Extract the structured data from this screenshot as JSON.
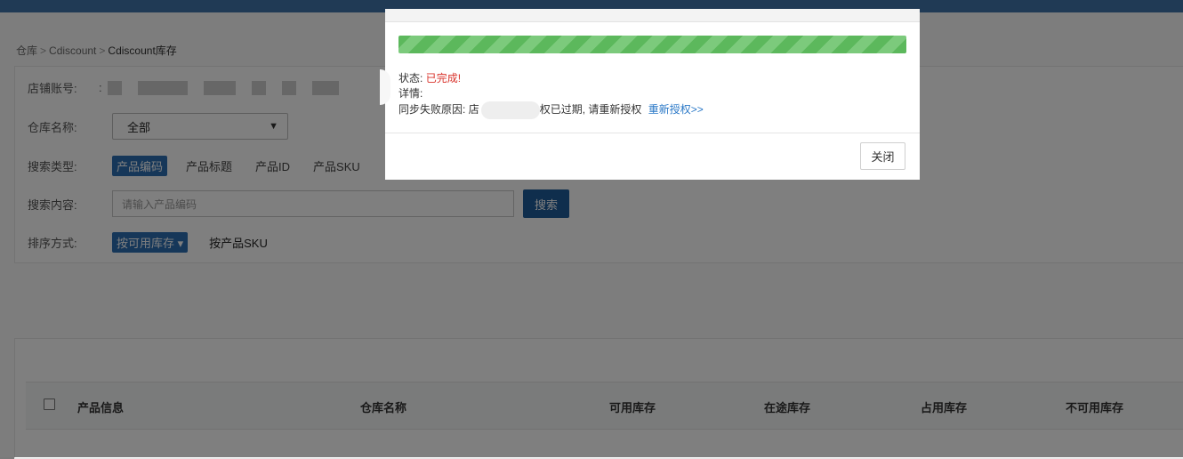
{
  "breadcrumb": [
    "仓库",
    "Cdiscount",
    "Cdiscount库存"
  ],
  "breadcrumb_sep": ">",
  "filters": {
    "shop_label": "店铺账号:",
    "shop_colon": ":",
    "warehouse_label": "仓库名称:",
    "warehouse_value": "全部",
    "search_type_label": "搜索类型:",
    "search_types": [
      "产品编码",
      "产品标题",
      "产品ID",
      "产品SKU"
    ],
    "search_content_label": "搜索内容:",
    "search_placeholder": "请输入产品编码",
    "search_button": "搜索",
    "sort_label": "排序方式:",
    "sort_active": "按可用库存 ▾",
    "sort_other": "按产品SKU"
  },
  "table": {
    "columns": [
      "产品信息",
      "仓库名称",
      "可用库存",
      "在途库存",
      "占用库存",
      "不可用库存"
    ]
  },
  "modal": {
    "progress_percent": 100,
    "status_label": "状态:",
    "status_value": "已完成!",
    "detail_label": "详情:",
    "reason_label": "同步失败原因:",
    "reason_prefix": "店",
    "reason_suffix": "权已过期, 请重新授权",
    "reauth_link": "重新授权>>",
    "close_button": "关闭"
  },
  "colors": {
    "accent": "#2d6fb3",
    "progress": "#5cb85c",
    "status_done": "#d9332b",
    "link": "#2a78c7",
    "topbar": "#203a55"
  }
}
